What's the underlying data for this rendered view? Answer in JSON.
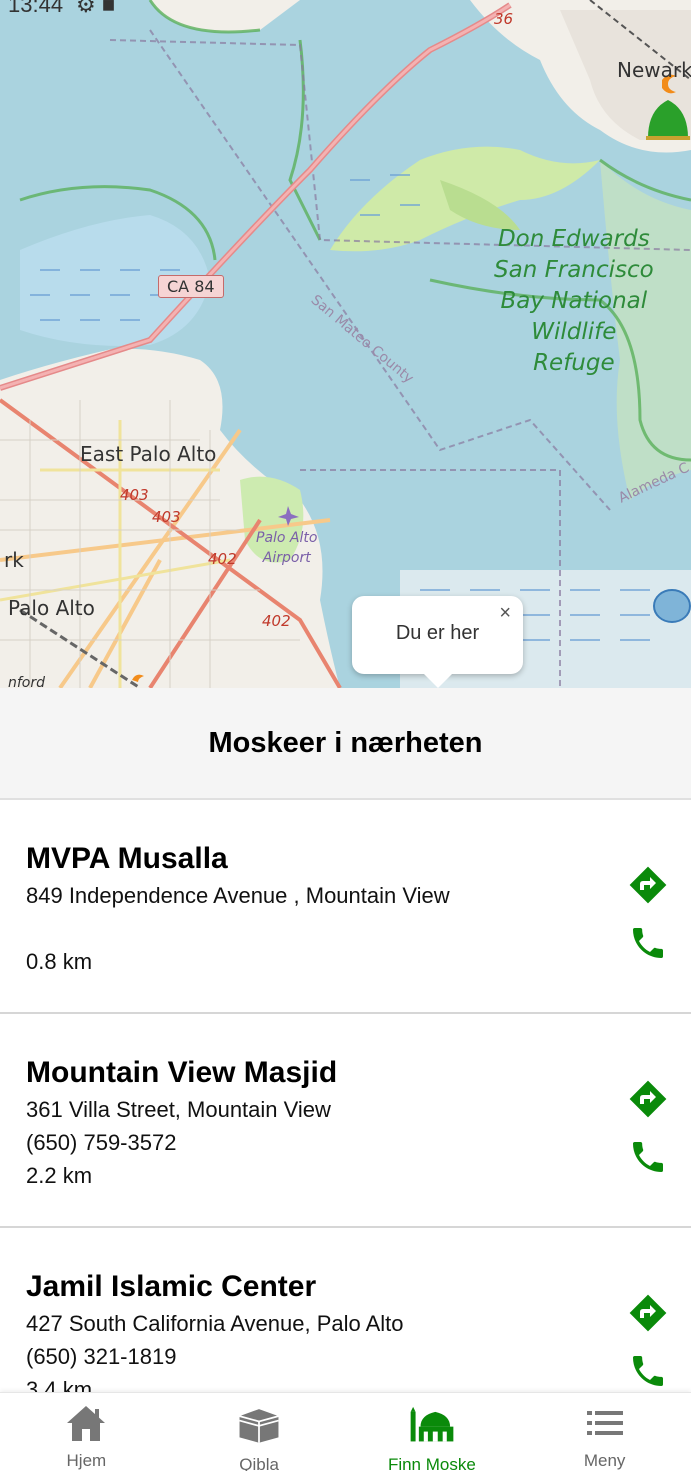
{
  "status_bar": {
    "time": "13:44"
  },
  "map": {
    "labels": {
      "east_palo_alto": "East Palo Alto",
      "palo_alto": "Palo Alto",
      "newark": "Newark",
      "refuge": [
        "Don Edwards",
        "San Francisco",
        "Bay National",
        "Wildlife",
        "Refuge"
      ],
      "county": "San Mateo County",
      "alameda": "Alameda C",
      "airport": [
        "Palo Alto",
        "Airport"
      ],
      "shield_ca84": "CA 84",
      "route_36": "36",
      "route_403a": "403",
      "route_403b": "403",
      "route_402a": "402",
      "route_402b": "402",
      "fragment_rk": "rk",
      "fragment_nford": "nford"
    },
    "popup": {
      "text": "Du er her",
      "close": "×"
    }
  },
  "list_header": {
    "title": "Moskeer i nærheten"
  },
  "mosques": [
    {
      "name": "MVPA Musalla",
      "address": "849 Independence Avenue , Mountain View",
      "phone": "",
      "distance": "0.8 km"
    },
    {
      "name": "Mountain View Masjid",
      "address": "361 Villa Street, Mountain View",
      "phone": "(650) 759-3572",
      "distance": "2.2 km"
    },
    {
      "name": "Jamil Islamic Center",
      "address": "427 South California Avenue, Palo Alto",
      "phone": "(650) 321-1819",
      "distance": "3.4 km"
    }
  ],
  "colors": {
    "accent": "#0a8a0a",
    "water": "#aad3df",
    "land": "#f2efe9"
  },
  "icons": {
    "directions": "directions-icon",
    "call": "phone-icon"
  },
  "bottom_nav": [
    {
      "label": "Hjem",
      "icon": "home-icon"
    },
    {
      "label": "Qibla",
      "icon": "kaaba-icon"
    },
    {
      "label": "Finn Moske",
      "icon": "mosque-icon",
      "active": true
    },
    {
      "label": "Meny",
      "icon": "menu-icon"
    }
  ]
}
